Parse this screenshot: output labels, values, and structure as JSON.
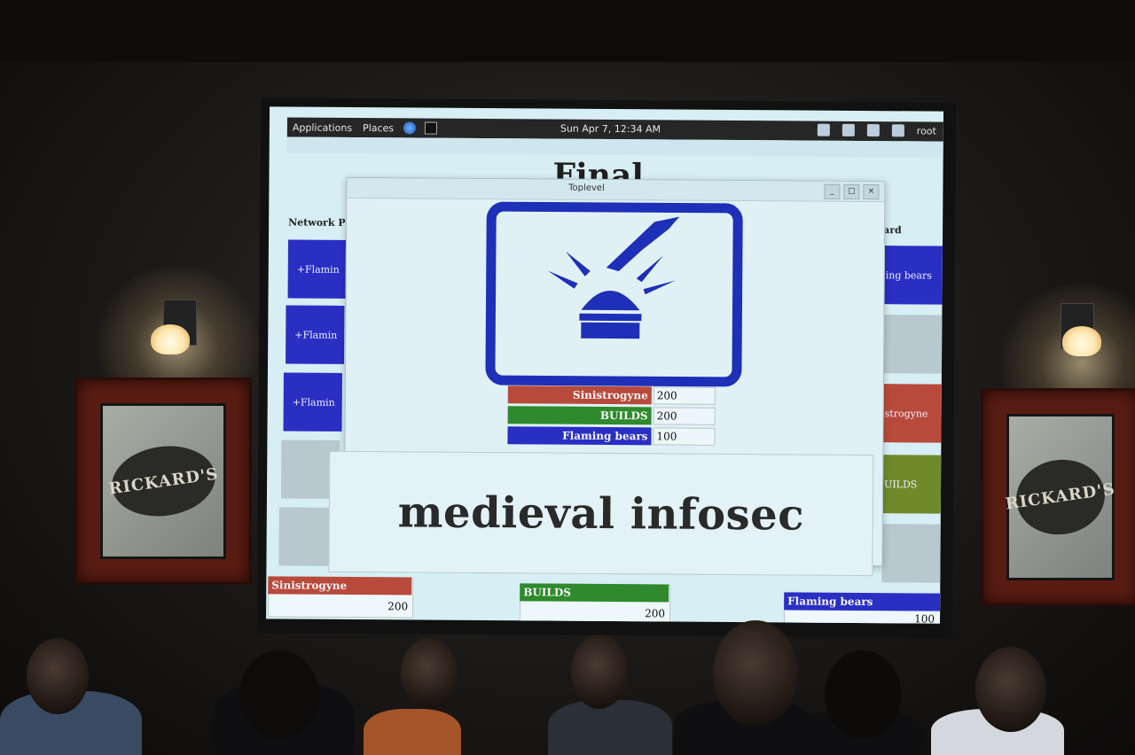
{
  "panel": {
    "applications": "Applications",
    "places": "Places",
    "clock": "Sun Apr  7, 12:34 AM",
    "user": "root"
  },
  "background_window": {
    "heading": "Final",
    "left_column_header": "Network P",
    "right_column_header": "ard",
    "left_tiles": [
      "+Flamin",
      "+Flamin",
      "+Flamin"
    ],
    "right_tiles": [
      "ing bears",
      "strogyne",
      "UILDS"
    ]
  },
  "scoreboard": [
    {
      "team": "Sinistrogyne",
      "score": "200",
      "color": "#b84a3c"
    },
    {
      "team": "BUILDS",
      "score": "200",
      "color": "#2e8a2c"
    },
    {
      "team": "Flaming bears",
      "score": "100",
      "color": "#2a2fc4"
    }
  ],
  "toplevel": {
    "title": "Toplevel",
    "rows": [
      {
        "team": "Sinistrogyne",
        "score": "200",
        "color": "#b84a3c"
      },
      {
        "team": "BUILDS",
        "score": "200",
        "color": "#2e8a2c"
      },
      {
        "team": "Flaming bears",
        "score": "100",
        "color": "#2a2fc4"
      }
    ],
    "caption": "medieval infosec",
    "logo_icon": "burger-buzzer-icon",
    "logo_color": "#1e2fb8"
  },
  "decor": {
    "sign_text": "RICKARD'S"
  }
}
